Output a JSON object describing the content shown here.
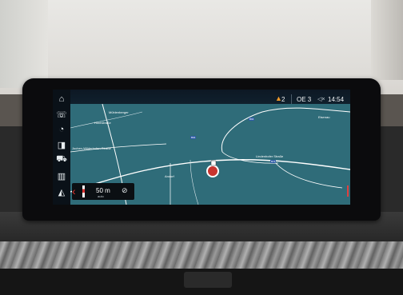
{
  "status": {
    "warning_count": "2",
    "station": "OE 3",
    "signal_icon": "signal-muted-icon",
    "time": "14:54"
  },
  "rail": {
    "icons": [
      "home-icon",
      "phone-icon",
      "climate-icon",
      "media-icon",
      "car-icon",
      "communication-icon",
      "navigation-icon"
    ]
  },
  "map": {
    "labels": {
      "l1": "Mühlenberger",
      "l2": "Hochstraße",
      "l3": "Jochen-Wilderhofen-Straße",
      "l4": "Lindenhofer Straße",
      "l5": "Eisenau",
      "l6": "Andorf"
    },
    "badges": {
      "b1": "B94",
      "b2": "B74",
      "b3": "B94"
    }
  },
  "scale": {
    "distance": "50 m",
    "mode": "auto"
  },
  "colors": {
    "map_bg": "#2f6c79",
    "route": "#e2342f",
    "warning": "#f09a2a"
  }
}
